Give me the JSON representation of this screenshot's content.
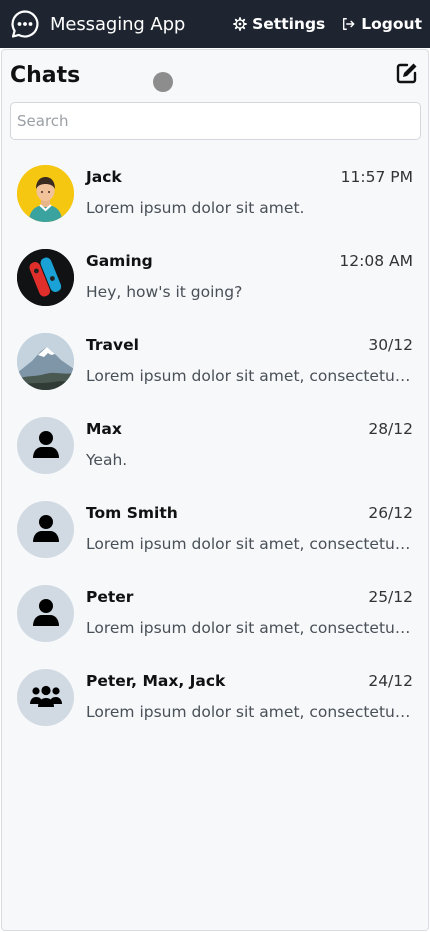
{
  "app": {
    "title": "Messaging App",
    "nav": {
      "settings": "Settings",
      "logout": "Logout"
    }
  },
  "colors": {
    "topbar": "#1e2531",
    "panel": "#f6f8fa",
    "avatar_placeholder": "#d1d9e2"
  },
  "chats_panel": {
    "title": "Chats",
    "compose_icon": "edit-icon",
    "search": {
      "placeholder": "Search",
      "value": ""
    },
    "items": [
      {
        "name": "Jack",
        "time": "11:57 PM",
        "preview": "Lorem ipsum dolor sit amet.",
        "avatar": "cartoon-person-avatar"
      },
      {
        "name": "Gaming",
        "time": "12:08 AM",
        "preview": "Hey, how's it going?",
        "avatar": "game-console-avatar"
      },
      {
        "name": "Travel",
        "time": "30/12",
        "preview": "Lorem ipsum dolor sit amet, consectetur adipiscing elit.",
        "avatar": "mountain-photo-avatar"
      },
      {
        "name": "Max",
        "time": "28/12",
        "preview": "Yeah.",
        "avatar": "user-icon"
      },
      {
        "name": "Tom Smith",
        "time": "26/12",
        "preview": "Lorem ipsum dolor sit amet, consectetur adipiscing elit.",
        "avatar": "user-icon"
      },
      {
        "name": "Peter",
        "time": "25/12",
        "preview": "Lorem ipsum dolor sit amet, consectetur adipiscing elit.",
        "avatar": "user-icon"
      },
      {
        "name": "Peter, Max, Jack",
        "time": "24/12",
        "preview": "Lorem ipsum dolor sit amet, consectetur adipiscing elit.",
        "avatar": "users-group-icon"
      }
    ]
  }
}
